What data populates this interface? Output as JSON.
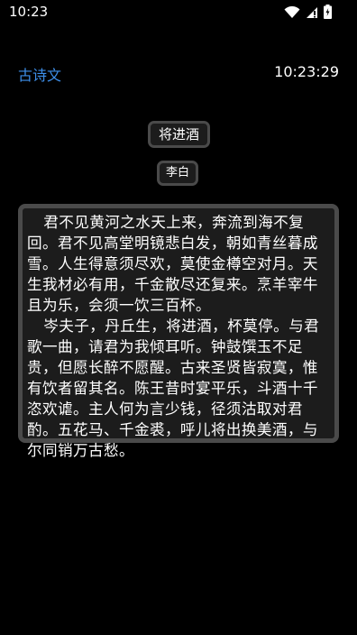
{
  "status_bar": {
    "time": "10:23",
    "icons": [
      "wifi-icon",
      "signal-icon",
      "battery-icon"
    ]
  },
  "header": {
    "app_title": "古诗文",
    "clock": "10:23:29"
  },
  "poem": {
    "title": "将进酒",
    "author": "李白",
    "paragraphs": [
      "君不见黄河之水天上来，奔流到海不复回。君不见高堂明镜悲白发，朝如青丝暮成雪。人生得意须尽欢，莫使金樽空对月。天生我材必有用，千金散尽还复来。烹羊宰牛且为乐，会须一饮三百杯。",
      "岑夫子，丹丘生，将进酒，杯莫停。与君歌一曲，请君为我倾耳听。钟鼓馔玉不足贵，但愿长醉不愿醒。古来圣贤皆寂寞，惟有饮者留其名。陈王昔时宴平乐，斗酒十千恣欢谑。主人何为言少钱，径须沽取对君酌。五花马、千金裘，呼儿将出换美酒，与尔同销万古愁。"
    ]
  },
  "colors": {
    "background": "#000000",
    "accent": "#3d8ee8",
    "panel": "#1c1c1c",
    "panel_border": "#4a4a4a"
  }
}
